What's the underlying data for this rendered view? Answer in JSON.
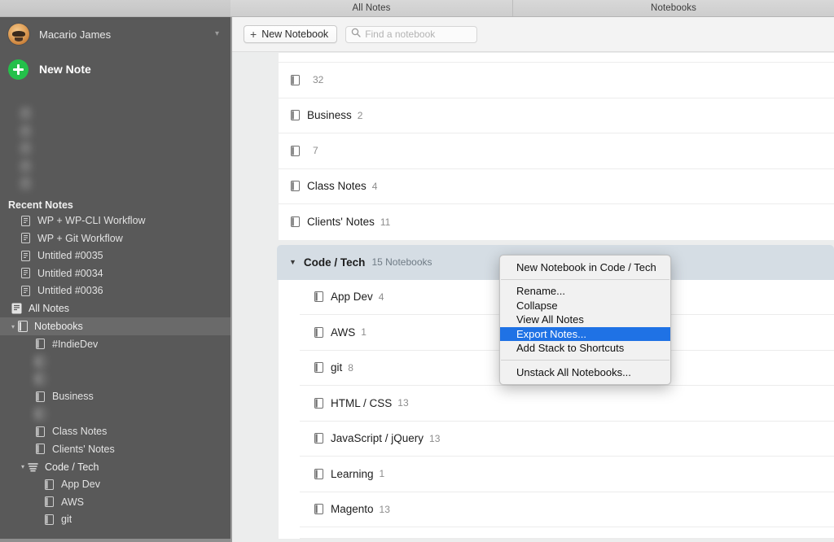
{
  "titlebar": {
    "left_segment_label": "",
    "middle_label": "All Notes",
    "right_label": "Notebooks"
  },
  "sidebar": {
    "account": {
      "name": "Macario James",
      "chevron_icon": "chevron-down-icon",
      "avatar_icon": "user-avatar"
    },
    "new_note": {
      "label": "New Note",
      "icon": "plus-circle-icon"
    },
    "shortcuts": [
      {
        "label": "",
        "icon": "note-icon",
        "redacted": true
      },
      {
        "label": "",
        "icon": "note-icon",
        "redacted": true
      },
      {
        "label": "",
        "icon": "note-icon",
        "redacted": true
      },
      {
        "label": "",
        "icon": "note-icon",
        "redacted": true
      },
      {
        "label": "",
        "icon": "note-icon",
        "redacted": true
      }
    ],
    "recent_notes_header": "Recent Notes",
    "recent_notes": [
      {
        "label": "WP + WP-CLI Workflow",
        "icon": "note-icon"
      },
      {
        "label": "WP + Git Workflow",
        "icon": "note-icon"
      },
      {
        "label": "Untitled #0035",
        "icon": "note-icon"
      },
      {
        "label": "Untitled #0034",
        "icon": "note-icon"
      },
      {
        "label": "Untitled #0036",
        "icon": "note-icon"
      }
    ],
    "all_notes": {
      "label": "All Notes",
      "icon": "notes-stack-icon"
    },
    "notebooks_root": {
      "label": "Notebooks",
      "icon": "notebook-icon",
      "disclosure_icon": "chevron-down-icon",
      "selected": true
    },
    "notebooks": [
      {
        "label": "#IndieDev",
        "icon": "notebook-icon",
        "redacted": false
      },
      {
        "label": "",
        "icon": "notebook-icon",
        "redacted": true
      },
      {
        "label": "",
        "icon": "notebook-icon",
        "redacted": true
      },
      {
        "label": "Business",
        "icon": "notebook-icon",
        "redacted": false
      },
      {
        "label": "",
        "icon": "notebook-icon",
        "redacted": true
      },
      {
        "label": "Class Notes",
        "icon": "notebook-icon",
        "redacted": false
      },
      {
        "label": "Clients' Notes",
        "icon": "notebook-icon",
        "redacted": false
      }
    ],
    "stack": {
      "label": "Code / Tech",
      "icon": "stack-icon",
      "disclosure_icon": "chevron-down-icon",
      "children": [
        {
          "label": "App Dev",
          "icon": "notebook-icon"
        },
        {
          "label": "AWS",
          "icon": "notebook-icon"
        },
        {
          "label": "git",
          "icon": "notebook-icon"
        }
      ]
    }
  },
  "toolbar": {
    "new_notebook_label": "New Notebook",
    "new_notebook_icon": "plus-icon",
    "search_placeholder": "Find a notebook",
    "search_value": "",
    "search_icon": "search-icon"
  },
  "notebook_list": {
    "rows_above_stack": [
      {
        "name": "",
        "count": "32",
        "icon": "notebook-icon",
        "redacted": true
      },
      {
        "name": "Business",
        "count": "2",
        "icon": "notebook-icon",
        "redacted": false
      },
      {
        "name": "",
        "count": "7",
        "icon": "notebook-icon",
        "redacted": true
      },
      {
        "name": "Class Notes",
        "count": "4",
        "icon": "notebook-icon",
        "redacted": false
      },
      {
        "name": "Clients' Notes",
        "count": "11",
        "icon": "notebook-icon",
        "redacted": false
      }
    ],
    "stack": {
      "name": "Code / Tech",
      "count_label": "15 Notebooks",
      "disclosure_icon": "chevron-down-icon",
      "children": [
        {
          "name": "App Dev",
          "count": "4",
          "icon": "notebook-icon"
        },
        {
          "name": "AWS",
          "count": "1",
          "icon": "notebook-icon"
        },
        {
          "name": "git",
          "count": "8",
          "icon": "notebook-icon"
        },
        {
          "name": "HTML / CSS",
          "count": "13",
          "icon": "notebook-icon"
        },
        {
          "name": "JavaScript / jQuery",
          "count": "13",
          "icon": "notebook-icon"
        },
        {
          "name": "Learning",
          "count": "1",
          "icon": "notebook-icon"
        },
        {
          "name": "Magento",
          "count": "13",
          "icon": "notebook-icon"
        }
      ]
    }
  },
  "context_menu": {
    "items_group1": [
      {
        "label": "New Notebook in Code / Tech",
        "selected": false
      }
    ],
    "items_group2": [
      {
        "label": "Rename...",
        "selected": false
      },
      {
        "label": "Collapse",
        "selected": false
      },
      {
        "label": "View All Notes",
        "selected": false
      },
      {
        "label": "Export Notes...",
        "selected": true
      },
      {
        "label": "Add Stack to Shortcuts",
        "selected": false
      }
    ],
    "items_group3": [
      {
        "label": "Unstack All Notebooks...",
        "selected": false
      }
    ]
  },
  "colors": {
    "sidebar_bg": "#595959",
    "accent_green": "#24c04a",
    "menu_highlight": "#1f72e5",
    "stack_header_bg": "#d5dde4"
  }
}
